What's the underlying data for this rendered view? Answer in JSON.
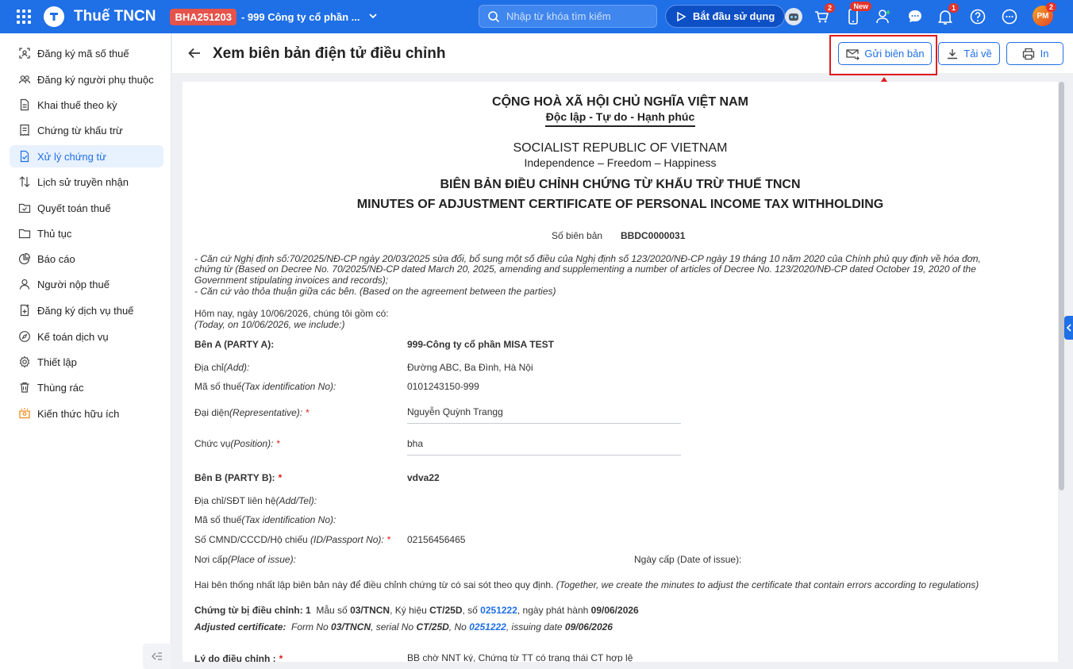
{
  "topbar": {
    "app_title": "Thuế TNCN",
    "org_code": "BHA251203",
    "org_name": "- 999 Công ty cổ phần ...",
    "search_placeholder": "Nhập từ khóa tìm kiếm",
    "start_label": "Bắt đầu sử dụng",
    "cart_badge": "2",
    "new_badge": "New",
    "notif_badge": "1",
    "avatar_text": "PM",
    "avatar_badge": "2"
  },
  "sidebar": {
    "items": [
      {
        "label": "Đăng ký mã số thuế",
        "icon": "scan-icon"
      },
      {
        "label": "Đăng ký người phụ thuộc",
        "icon": "users-icon"
      },
      {
        "label": "Khai thuế theo kỳ",
        "icon": "document-icon"
      },
      {
        "label": "Chứng từ khấu trừ",
        "icon": "receipt-icon"
      },
      {
        "label": "Xử lý chứng từ",
        "icon": "document-check-icon"
      },
      {
        "label": "Lịch sử truyền nhận",
        "icon": "transfer-icon"
      },
      {
        "label": "Quyết toán thuế",
        "icon": "folder-check-icon"
      },
      {
        "label": "Thủ tục",
        "icon": "folder-icon"
      },
      {
        "label": "Báo cáo",
        "icon": "pie-chart-icon"
      },
      {
        "label": "Người nộp thuế",
        "icon": "user-icon"
      },
      {
        "label": "Đăng ký dịch vụ thuế",
        "icon": "document-add-icon"
      },
      {
        "label": "Kế toán dịch vụ",
        "icon": "compass-icon"
      },
      {
        "label": "Thiết lập",
        "icon": "gear-icon"
      },
      {
        "label": "Thùng rác",
        "icon": "trash-icon"
      },
      {
        "label": "Kiến thức hữu ích",
        "icon": "knowledge-icon"
      }
    ]
  },
  "header": {
    "title": "Xem biên bản điện tử điều chỉnh",
    "send_label": "Gửi biên bản",
    "download_label": "Tải về",
    "print_label": "In"
  },
  "doc": {
    "nation_vn": "CỘNG HOÀ XÃ HỘI CHỦ NGHĨA VIỆT NAM",
    "motto_vn": "Độc lập - Tự do - Hạnh phúc",
    "nation_en": "SOCIALIST REPUBLIC OF VIETNAM",
    "motto_en": "Independence – Freedom – Happiness",
    "title_vn": "BIÊN BẢN ĐIỀU CHỈNH CHỨNG TỪ KHẤU TRỪ THUẾ TNCN",
    "title_en": "MINUTES OF ADJUSTMENT CERTIFICATE OF PERSONAL INCOME TAX WITHHOLDING",
    "minutes_no_label": "Số biên bản",
    "minutes_no": "BBDC0000031",
    "basis_1a": "- Căn cứ Nghị định số:70/2025/NĐ-CP ngày 20/03/2025 sửa đổi, bổ sung một số điều của Nghị định số 123/2020/NĐ-CP ngày 19 tháng 10 năm 2020 của Chính phủ quy định về hóa đơn,",
    "basis_1b": "chứng từ (Based on Decree No. 70/2025/NĐ-CP dated March 20, 2025, amending and supplementing a number of articles of Decree No. 123/2020/NĐ-CP dated October 19, 2020 of the",
    "basis_1c": "Government stipulating invoices and records);",
    "basis_2": "- Căn cứ vào thỏa thuận giữa các bên. (Based on the agreement between the parties)",
    "today_vn": "Hôm nay, ngày 10/06/2026, chúng tôi gồm có:",
    "today_en": "(Today, on 10/06/2026, we include:)",
    "party_a_label": "Bên A (PARTY A):",
    "party_a_name": "999-Công ty cổ phần MISA TEST",
    "address_label": "Địa chỉ",
    "address_label_en": "(Add):",
    "party_a_address": "Đường ABC, Ba Đình, Hà Nội",
    "tax_label": "Mã số thuế",
    "tax_label_en": "(Tax identification No):",
    "party_a_tax": "0101243150-999",
    "rep_label": "Đại diện",
    "rep_label_en": "(Representative):",
    "party_a_rep": "Nguyễn Quỳnh Trangg",
    "pos_label": "Chức vụ",
    "pos_label_en": "(Position):",
    "party_a_pos": "bha",
    "party_b_label": "Bên B (PARTY B):",
    "party_b_name": "vdva22",
    "addr_tel_label": "Địa chỉ/SĐT liên hệ",
    "addr_tel_label_en": "(Add/Tel):",
    "id_label": "Số CMND/CCCD/Hộ chiếu",
    "id_label_en": "(ID/Passport No):",
    "party_b_id": "02156456465",
    "place_label": "Nơi cấp",
    "place_label_en": "(Place of issue):",
    "date_issue_label": "Ngày cấp (Date of issue):",
    "agree_vn": "Hai bên thống nhất lập biên bản này để điều chỉnh chứng từ có sai sót theo quy định.",
    "agree_en": "(Together, we create the minutes to adjust the certificate that contain errors according to regulations)",
    "cert_vn_label": "Chứng từ bị điều chỉnh: 1",
    "cert_form_vn": "Mẫu số",
    "cert_form": "03/TNCN",
    "cert_serial_vn": ", Ký hiệu",
    "cert_serial": "CT/25D",
    "cert_no_vn": ", số",
    "cert_no": "0251222",
    "cert_date_vn": ", ngày phát hành",
    "cert_date": "09/06/2026",
    "cert_en_label": "Adjusted certificate:",
    "cert_form_en": "Form No",
    "cert_serial_en": ", serial No",
    "cert_no_en": ", No",
    "cert_date_en": ", issuing date",
    "reason_label": "Lý do điều chỉnh :",
    "reason": "BB chờ NNT ký, Chứng từ TT có trạng thái CT hợp lệ"
  }
}
